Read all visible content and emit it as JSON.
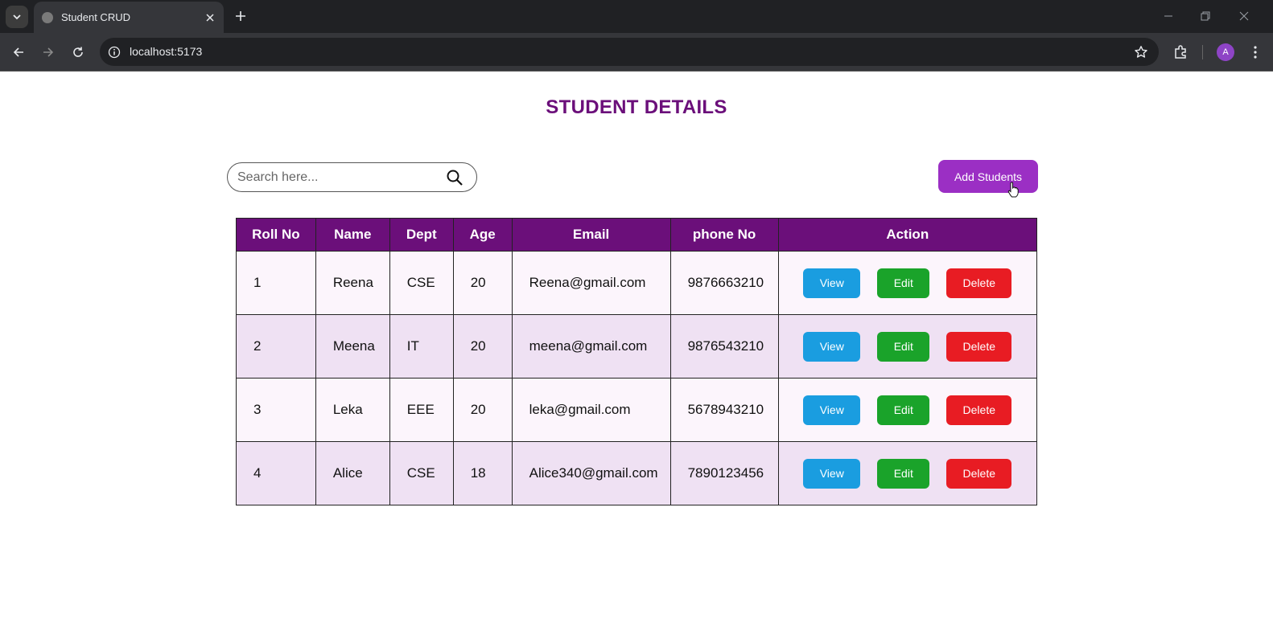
{
  "browser": {
    "tab_title": "Student CRUD",
    "url": "localhost:5173",
    "avatar_initial": "A"
  },
  "page": {
    "title": "STUDENT DETAILS",
    "search_placeholder": "Search here...",
    "add_button": "Add Students"
  },
  "table": {
    "headers": [
      "Roll No",
      "Name",
      "Dept",
      "Age",
      "Email",
      "phone No",
      "Action"
    ],
    "rows": [
      {
        "roll": "1",
        "name": "Reena",
        "dept": "CSE",
        "age": "20",
        "email": "Reena@gmail.com",
        "phone": "9876663210"
      },
      {
        "roll": "2",
        "name": "Meena",
        "dept": "IT",
        "age": "20",
        "email": "meena@gmail.com",
        "phone": "9876543210"
      },
      {
        "roll": "3",
        "name": "Leka",
        "dept": "EEE",
        "age": "20",
        "email": "leka@gmail.com",
        "phone": "5678943210"
      },
      {
        "roll": "4",
        "name": "Alice",
        "dept": "CSE",
        "age": "18",
        "email": "Alice340@gmail.com",
        "phone": "7890123456"
      }
    ],
    "actions": {
      "view": "View",
      "edit": "Edit",
      "delete": "Delete"
    }
  },
  "colors": {
    "primary": "#6b0f7a",
    "add_button": "#9b2fc4",
    "view": "#1a9de0",
    "edit": "#1aa32a",
    "delete": "#e81c23"
  }
}
